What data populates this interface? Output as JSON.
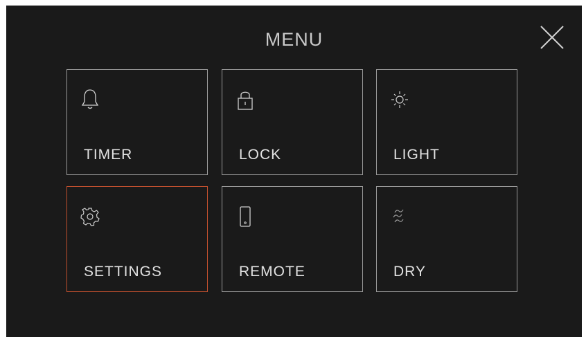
{
  "header": {
    "title": "MENU",
    "close_icon": "close-icon"
  },
  "colors": {
    "background": "#1a1a1a",
    "tile_border": "#9a9a9a",
    "active_border": "#c1502e",
    "text": "#e2e2e2"
  },
  "menu": {
    "items": [
      {
        "label": "TIMER",
        "icon": "bell-icon",
        "active": false
      },
      {
        "label": "LOCK",
        "icon": "padlock-icon",
        "active": false
      },
      {
        "label": "LIGHT",
        "icon": "sun-icon",
        "active": false
      },
      {
        "label": "SETTINGS",
        "icon": "gear-icon",
        "active": true
      },
      {
        "label": "REMOTE",
        "icon": "phone-icon",
        "active": false
      },
      {
        "label": "DRY",
        "icon": "dry-waves-icon",
        "active": false
      }
    ]
  }
}
